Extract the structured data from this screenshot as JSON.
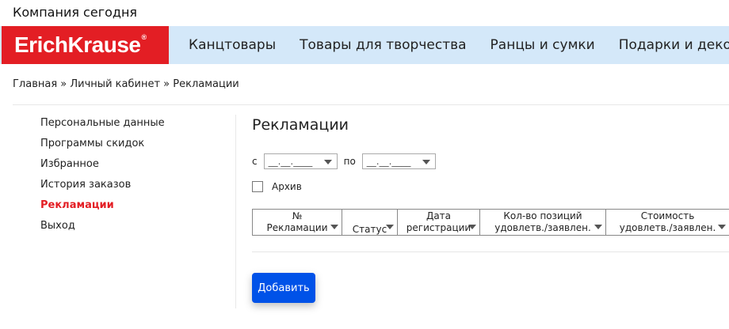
{
  "header": {
    "top_link": "Компания сегодня"
  },
  "logo": {
    "text": "ErichKrause",
    "reg": "®",
    "brand_color": "#e31e24"
  },
  "nav": {
    "items": [
      "Канцтовары",
      "Товары для творчества",
      "Ранцы и сумки",
      "Подарки и декор"
    ]
  },
  "breadcrumb": {
    "items": [
      "Главная",
      "Личный кабинет",
      "Рекламации"
    ],
    "separator": "»"
  },
  "sidebar": {
    "items": [
      {
        "label": "Персональные данные",
        "active": false
      },
      {
        "label": "Программы скидок",
        "active": false
      },
      {
        "label": "Избранное",
        "active": false
      },
      {
        "label": "История заказов",
        "active": false
      },
      {
        "label": "Рекламации",
        "active": true
      },
      {
        "label": "Выход",
        "active": false
      }
    ]
  },
  "main": {
    "title": "Рекламации",
    "filter": {
      "from_label": "с",
      "to_label": "по",
      "from_value": "__.__.____",
      "to_value": "__.__.____"
    },
    "archive_label": "Архив",
    "archive_checked": false,
    "columns": [
      {
        "line1": "№",
        "line2": "Рекламации"
      },
      {
        "line1": "",
        "line2": "Статус"
      },
      {
        "line1": "Дата",
        "line2": "регистрации"
      },
      {
        "line1": "Кол-во позиций",
        "line2": "удовлетв./заявлен."
      },
      {
        "line1": "Стоимость",
        "line2": "удовлетв./заявлен."
      }
    ],
    "add_button": "Добавить",
    "button_color": "#0052e8"
  }
}
